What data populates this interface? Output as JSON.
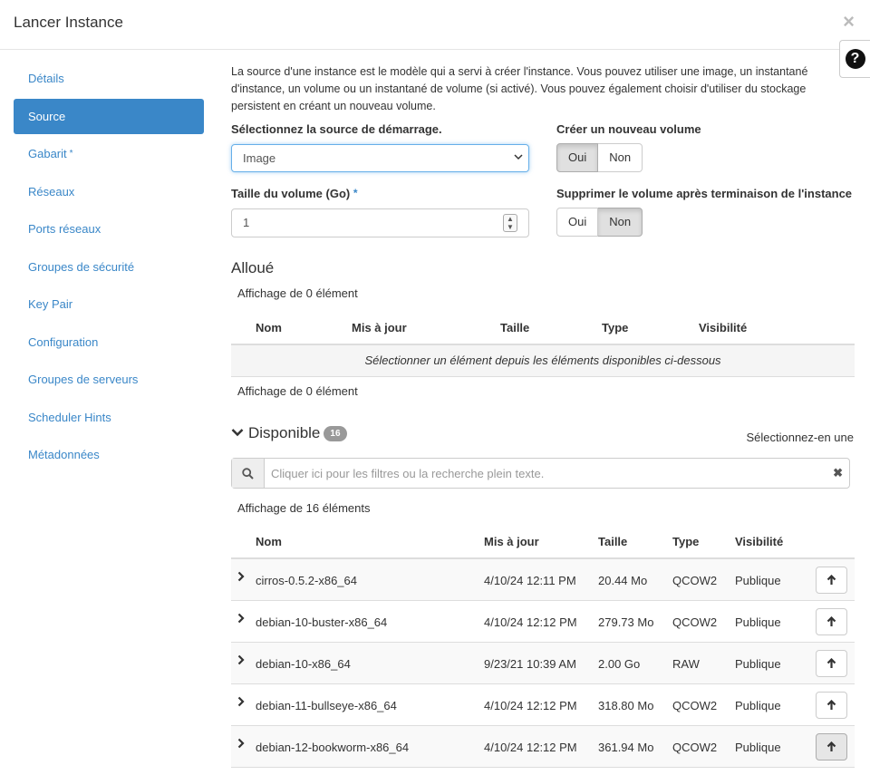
{
  "modal": {
    "title": "Lancer Instance",
    "close_glyph": "×",
    "help_glyph": "?"
  },
  "sidebar": {
    "items": [
      {
        "label": "Détails",
        "required": false,
        "active": false
      },
      {
        "label": "Source",
        "required": false,
        "active": true
      },
      {
        "label": "Gabarit",
        "required": true,
        "active": false
      },
      {
        "label": "Réseaux",
        "required": false,
        "active": false
      },
      {
        "label": "Ports réseaux",
        "required": false,
        "active": false
      },
      {
        "label": "Groupes de sécurité",
        "required": false,
        "active": false
      },
      {
        "label": "Key Pair",
        "required": false,
        "active": false
      },
      {
        "label": "Configuration",
        "required": false,
        "active": false
      },
      {
        "label": "Groupes de serveurs",
        "required": false,
        "active": false
      },
      {
        "label": "Scheduler Hints",
        "required": false,
        "active": false
      },
      {
        "label": "Métadonnées",
        "required": false,
        "active": false
      }
    ],
    "required_mark": "*"
  },
  "intro": "La source d'une instance est le modèle qui a servi à créer l'instance. Vous pouvez utiliser une image, un instantané d'instance, un volume ou un instantané de volume (si activé). Vous pouvez également choisir d'utiliser du stockage persistent en créant un nouveau volume.",
  "boot_source": {
    "label": "Sélectionnez la source de démarrage.",
    "value": "Image"
  },
  "volume_size": {
    "label": "Taille du volume (Go)",
    "required_mark": "*",
    "value": "1"
  },
  "create_volume": {
    "label": "Créer un nouveau volume",
    "yes": "Oui",
    "no": "Non",
    "selected": "yes"
  },
  "delete_volume": {
    "label": "Supprimer le volume après terminaison de l'instance",
    "yes": "Oui",
    "no": "Non",
    "selected": "no"
  },
  "allocated": {
    "title": "Alloué",
    "count_top": "Affichage de 0 élément",
    "count_bottom": "Affichage de 0 élément",
    "columns": [
      "Nom",
      "Mis à jour",
      "Taille",
      "Type",
      "Visibilité"
    ],
    "empty_message": "Sélectionner un élément depuis les éléments disponibles ci-dessous"
  },
  "available": {
    "title": "Disponible",
    "badge": "16",
    "select_hint": "Sélectionnez-en une",
    "search_placeholder": "Cliquer ici pour les filtres ou la recherche plein texte.",
    "clear_glyph": "✖",
    "count": "Affichage de 16 éléments",
    "columns": [
      "Nom",
      "Mis à jour",
      "Taille",
      "Type",
      "Visibilité"
    ],
    "rows": [
      {
        "name": "cirros-0.5.2-x86_64",
        "updated": "4/10/24 12:11 PM",
        "size": "20.44 Mo",
        "type": "QCOW2",
        "visibility": "Publique"
      },
      {
        "name": "debian-10-buster-x86_64",
        "updated": "4/10/24 12:12 PM",
        "size": "279.73 Mo",
        "type": "QCOW2",
        "visibility": "Publique"
      },
      {
        "name": "debian-10-x86_64",
        "updated": "9/23/21 10:39 AM",
        "size": "2.00 Go",
        "type": "RAW",
        "visibility": "Publique"
      },
      {
        "name": "debian-11-bullseye-x86_64",
        "updated": "4/10/24 12:12 PM",
        "size": "318.80 Mo",
        "type": "QCOW2",
        "visibility": "Publique"
      },
      {
        "name": "debian-12-bookworm-x86_64",
        "updated": "4/10/24 12:12 PM",
        "size": "361.94 Mo",
        "type": "QCOW2",
        "visibility": "Publique"
      }
    ]
  },
  "colors": {
    "accent": "#3a87c8",
    "focus": "#66afe9"
  }
}
